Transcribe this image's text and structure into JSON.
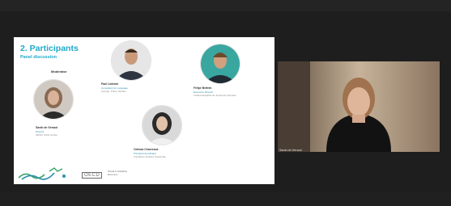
{
  "slide": {
    "title": "2. Participants",
    "subtitle": "Panel discussion",
    "moderator_label": "Moderator",
    "participants": [
      {
        "name": "Sarah de Geraud",
        "role": "Director",
        "org": "OECD, Paris Center"
      },
      {
        "name": "Paul Linholm",
        "role": "Consultant for Language",
        "org": "Foreign, Policy Studies"
      },
      {
        "name": "Felipe Beltrán",
        "role": "Executive Director",
        "org": "Instituto Español de Juventud y Empleo"
      },
      {
        "name": "Odessa Chavreaux",
        "role": "Principal Coordinator",
        "org": "Fundación Empleo Sostenible"
      }
    ],
    "footer": {
      "logo": "OECD",
      "program": "Social & Solidarity",
      "program_sub": "Economy"
    }
  },
  "video": {
    "speaker_name": "Sarah de Geraud"
  },
  "icons": {
    "footer_graphic": "bird-waves-graphic"
  },
  "colors": {
    "accent": "#1ea9c8",
    "background": "#1e1e1e"
  }
}
